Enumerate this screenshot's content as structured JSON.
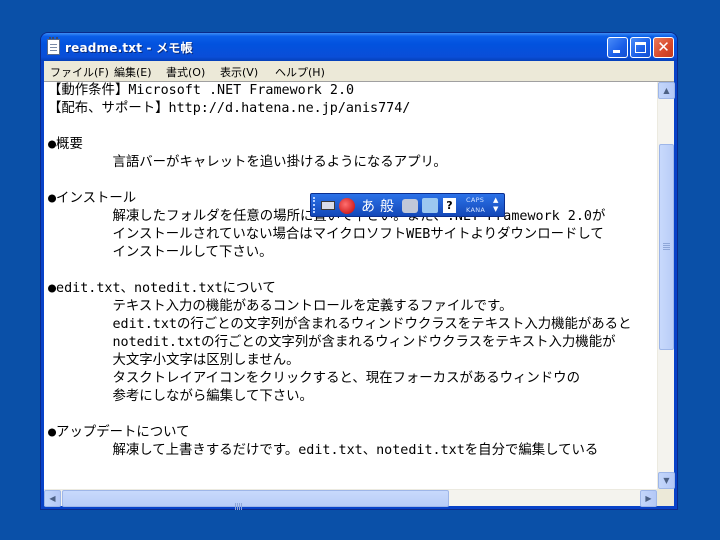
{
  "window": {
    "title": "readme.txt - メモ帳",
    "buttons": {
      "minimize_icon": "minimize-icon",
      "maximize_icon": "maximize-icon",
      "close_icon": "close-icon",
      "close_glyph": "✕"
    }
  },
  "menu": {
    "items": [
      "ファイル(F)",
      "編集(E)",
      "書式(O)",
      "表示(V)",
      "ヘルプ(H)"
    ]
  },
  "document": {
    "lines": [
      "【動作条件】Microsoft .NET Framework 2.0",
      "【配布、サポート】http://d.hatena.ne.jp/anis774/",
      "",
      "●概要",
      "        言語バーがキャレットを追い掛けるようになるアプリ。",
      "",
      "●インストール",
      "        解凍したフォルダを任意の場所に置いて下さい。また、.NET Framework 2.0が",
      "        インストールされていない場合はマイクロソフトWEBサイトよりダウンロードして",
      "        インストールして下さい。",
      "",
      "●edit.txt、notedit.txtについて",
      "        テキスト入力の機能があるコントロールを定義するファイルです。",
      "        edit.txtの行ごとの文字列が含まれるウィンドウクラスをテキスト入力機能があると",
      "        notedit.txtの行ごとの文字列が含まれるウィンドウクラスをテキスト入力機能が",
      "        大文字小文字は区別しません。",
      "        タスクトレイアイコンをクリックすると、現在フォーカスがあるウィンドウの",
      "        参考にしながら編集して下さい。",
      "",
      "●アップデートについて",
      "        解凍して上書きするだけです。edit.txt、notedit.txtを自分で編集している"
    ]
  },
  "language_bar": {
    "mode_label": "あ",
    "conversion_label": "般",
    "help_label": "?",
    "caps_label": "CAPS",
    "kana_label": "KANA",
    "up_glyph": "▲",
    "down_glyph": "▼",
    "icons": [
      "keyboard-icon",
      "ime-ball-icon",
      "tools-icon",
      "pad-icon",
      "help-icon"
    ]
  },
  "scrollbars": {
    "up_glyph": "▲",
    "down_glyph": "▼",
    "left_glyph": "◀",
    "right_glyph": "▶"
  }
}
